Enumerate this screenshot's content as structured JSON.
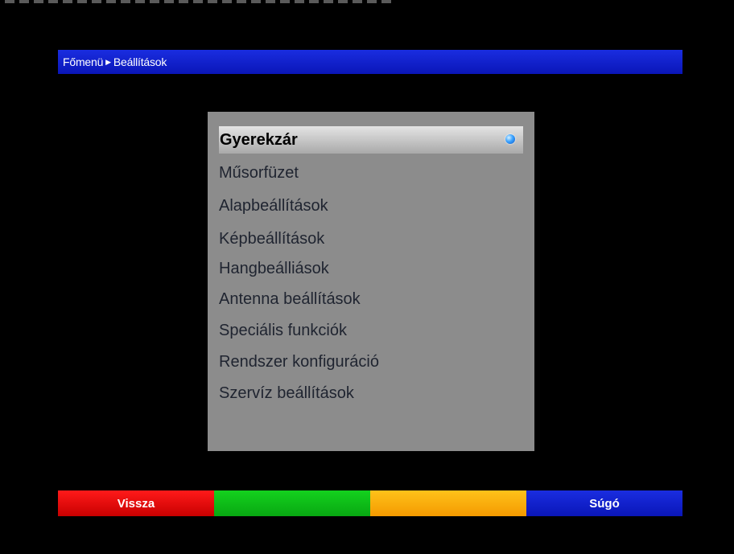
{
  "breadcrumb": {
    "root": "Főmenü",
    "separator": "▶",
    "current": "Beállítások"
  },
  "menu": {
    "items": [
      {
        "label": "Gyerekzár",
        "selected": true
      },
      {
        "label": "Műsorfüzet",
        "selected": false
      },
      {
        "label": "Alapbeállítások",
        "selected": false
      },
      {
        "label": "Képbeállítások",
        "selected": false
      },
      {
        "label": "Hangbeálliások",
        "selected": false
      },
      {
        "label": "Antenna beállítások",
        "selected": false
      },
      {
        "label": "Speciális funkciók",
        "selected": false
      },
      {
        "label": "Rendszer konfiguráció",
        "selected": false
      },
      {
        "label": "Szervíz beállítások",
        "selected": false
      }
    ]
  },
  "buttons": {
    "red": "Vissza",
    "green": "",
    "yellow": "",
    "blue": "Súgó"
  },
  "colors": {
    "header_blue": "#1a2de0",
    "panel_gray": "#8c8c8c",
    "red": "#ff1a1a",
    "green": "#14d11e",
    "yellow": "#ffc21a",
    "blue": "#1a2de0"
  },
  "icons": {
    "selection_indicator": "blue-orb-icon",
    "breadcrumb_separator": "triangle-right-icon"
  }
}
